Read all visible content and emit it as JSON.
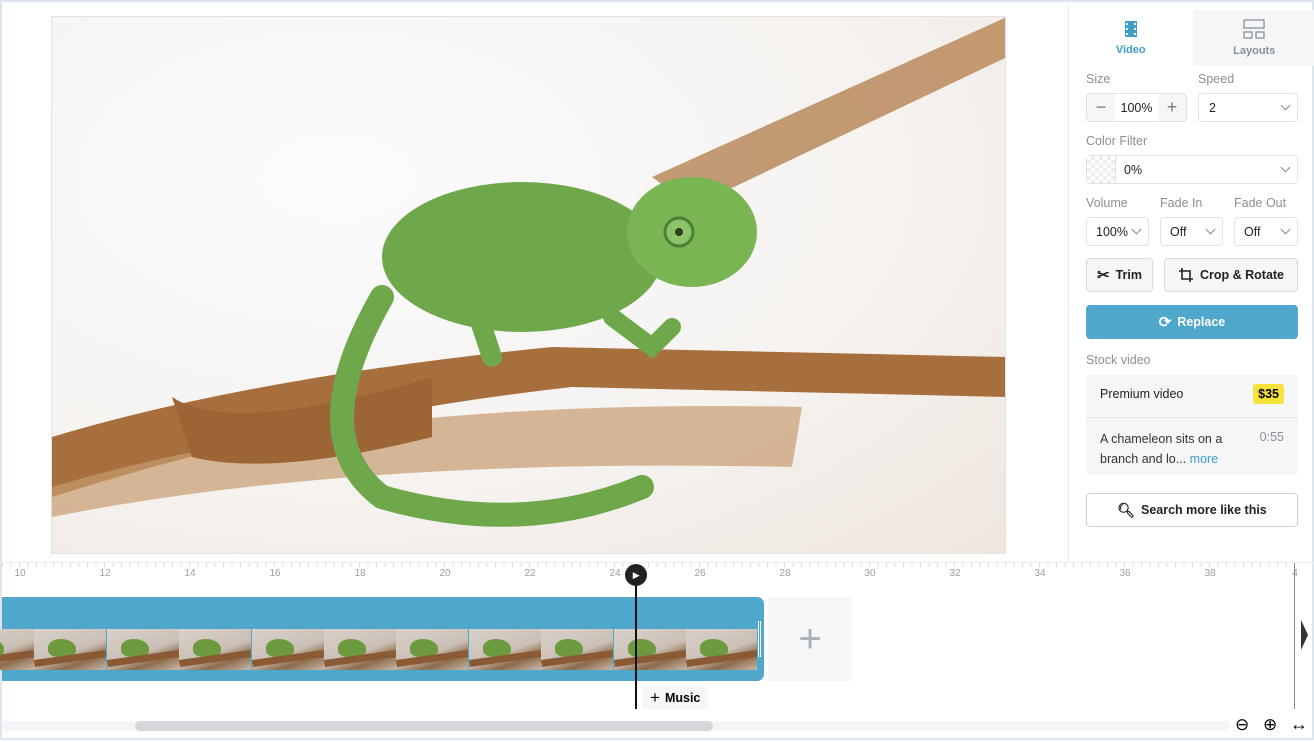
{
  "tabs": [
    {
      "label": "Video",
      "icon": "film-icon",
      "active": true
    },
    {
      "label": "Layouts",
      "icon": "layout-icon",
      "active": false
    }
  ],
  "size": {
    "label": "Size",
    "value": "100%"
  },
  "speed": {
    "label": "Speed",
    "value": "2"
  },
  "color_filter": {
    "label": "Color Filter",
    "value": "0%"
  },
  "volume": {
    "label": "Volume",
    "value": "100%"
  },
  "fade_in": {
    "label": "Fade In",
    "value": "Off"
  },
  "fade_out": {
    "label": "Fade Out",
    "value": "Off"
  },
  "buttons": {
    "trim": "Trim",
    "crop": "Crop & Rotate",
    "replace": "Replace",
    "search_more": "Search more like this"
  },
  "stock": {
    "label": "Stock video",
    "premium": "Premium video",
    "price": "$35",
    "description": "A chameleon sits on a branch and lo...",
    "more": "more",
    "duration": "0:55"
  },
  "timeline": {
    "ticks": [
      "10",
      "12",
      "14",
      "16",
      "18",
      "20",
      "22",
      "24",
      "26",
      "28",
      "30",
      "32",
      "34",
      "36",
      "38",
      "4"
    ],
    "playhead": 24.5,
    "music_label": "Music"
  },
  "colors": {
    "accent": "#4fa7cc",
    "price_badge": "#f7e23a"
  }
}
